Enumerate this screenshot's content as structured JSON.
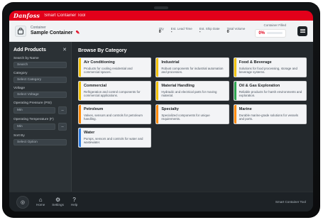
{
  "app": {
    "brand": "Danfoss",
    "tool_title": "Smart Container Tool",
    "colors": {
      "brand_red": "#e2001a",
      "accent_yellow": "#f2c200",
      "accent_green": "#2ea44f",
      "accent_blue": "#2f7de1",
      "accent_orange": "#ff8a00"
    }
  },
  "header": {
    "kicker": "Container",
    "title": "Sample Container",
    "stats": [
      {
        "k": "Qty",
        "v": "0"
      },
      {
        "k": "Est. Lead Time",
        "v": "-"
      },
      {
        "k": "Est. Ship Date",
        "v": "-"
      },
      {
        "k": "Total Volume",
        "v": "0"
      }
    ],
    "filled_label": "Container Filled",
    "filled_percent": "0%",
    "filled_fraction": 0
  },
  "sidebar": {
    "title": "Add Products",
    "close_icon": "close-icon",
    "fields": [
      {
        "label": "Search by Name",
        "placeholder": "Search"
      },
      {
        "label": "Category",
        "placeholder": "Select Category"
      },
      {
        "label": "Voltage",
        "placeholder": "Select Voltage"
      },
      {
        "label": "Operating Pressure (PSI)",
        "placeholder": "Min"
      },
      {
        "label": "Operating Temperature (F)",
        "placeholder": "Min"
      },
      {
        "label": "Sort By",
        "placeholder": "Select Option"
      }
    ],
    "reset_label": "Reset"
  },
  "main": {
    "title": "Browse By Category",
    "cards": [
      {
        "title": "Air Conditioning",
        "desc": "Products for cooling residential and commercial spaces.",
        "accent": "#f2c200"
      },
      {
        "title": "Industrial",
        "desc": "Robust components for industrial automation and processes.",
        "accent": "#f2c200"
      },
      {
        "title": "Food & Beverage",
        "desc": "Solutions for food processing, storage and beverage systems.",
        "accent": "#f2c200"
      },
      {
        "title": "Commercial",
        "desc": "Refrigeration and control components for commercial applications.",
        "accent": "#f2c200"
      },
      {
        "title": "Material Handling",
        "desc": "Hydraulic and electrical parts for moving material.",
        "accent": "#f2c200"
      },
      {
        "title": "Oil & Gas Exploration",
        "desc": "Reliable products for harsh environments and exploration.",
        "accent": "#2ea44f"
      },
      {
        "title": "Petroleum",
        "desc": "Valves, sensors and controls for petroleum handling.",
        "accent": "#ff8a00"
      },
      {
        "title": "Specialty",
        "desc": "Specialized components for unique requirements.",
        "accent": "#ff8a00"
      },
      {
        "title": "Marine",
        "desc": "Durable marine-grade solutions for vessels and ports.",
        "accent": "#ff8a00"
      },
      {
        "title": "Water",
        "desc": "Pumps, sensors and controls for water and wastewater.",
        "accent": "#2f7de1"
      }
    ]
  },
  "footer": {
    "items": [
      {
        "icon": "home-icon",
        "label": "Home"
      },
      {
        "icon": "gear-icon",
        "label": "Settings"
      },
      {
        "icon": "help-icon",
        "label": "Help"
      }
    ],
    "right_text": "Smart Container Tool"
  }
}
